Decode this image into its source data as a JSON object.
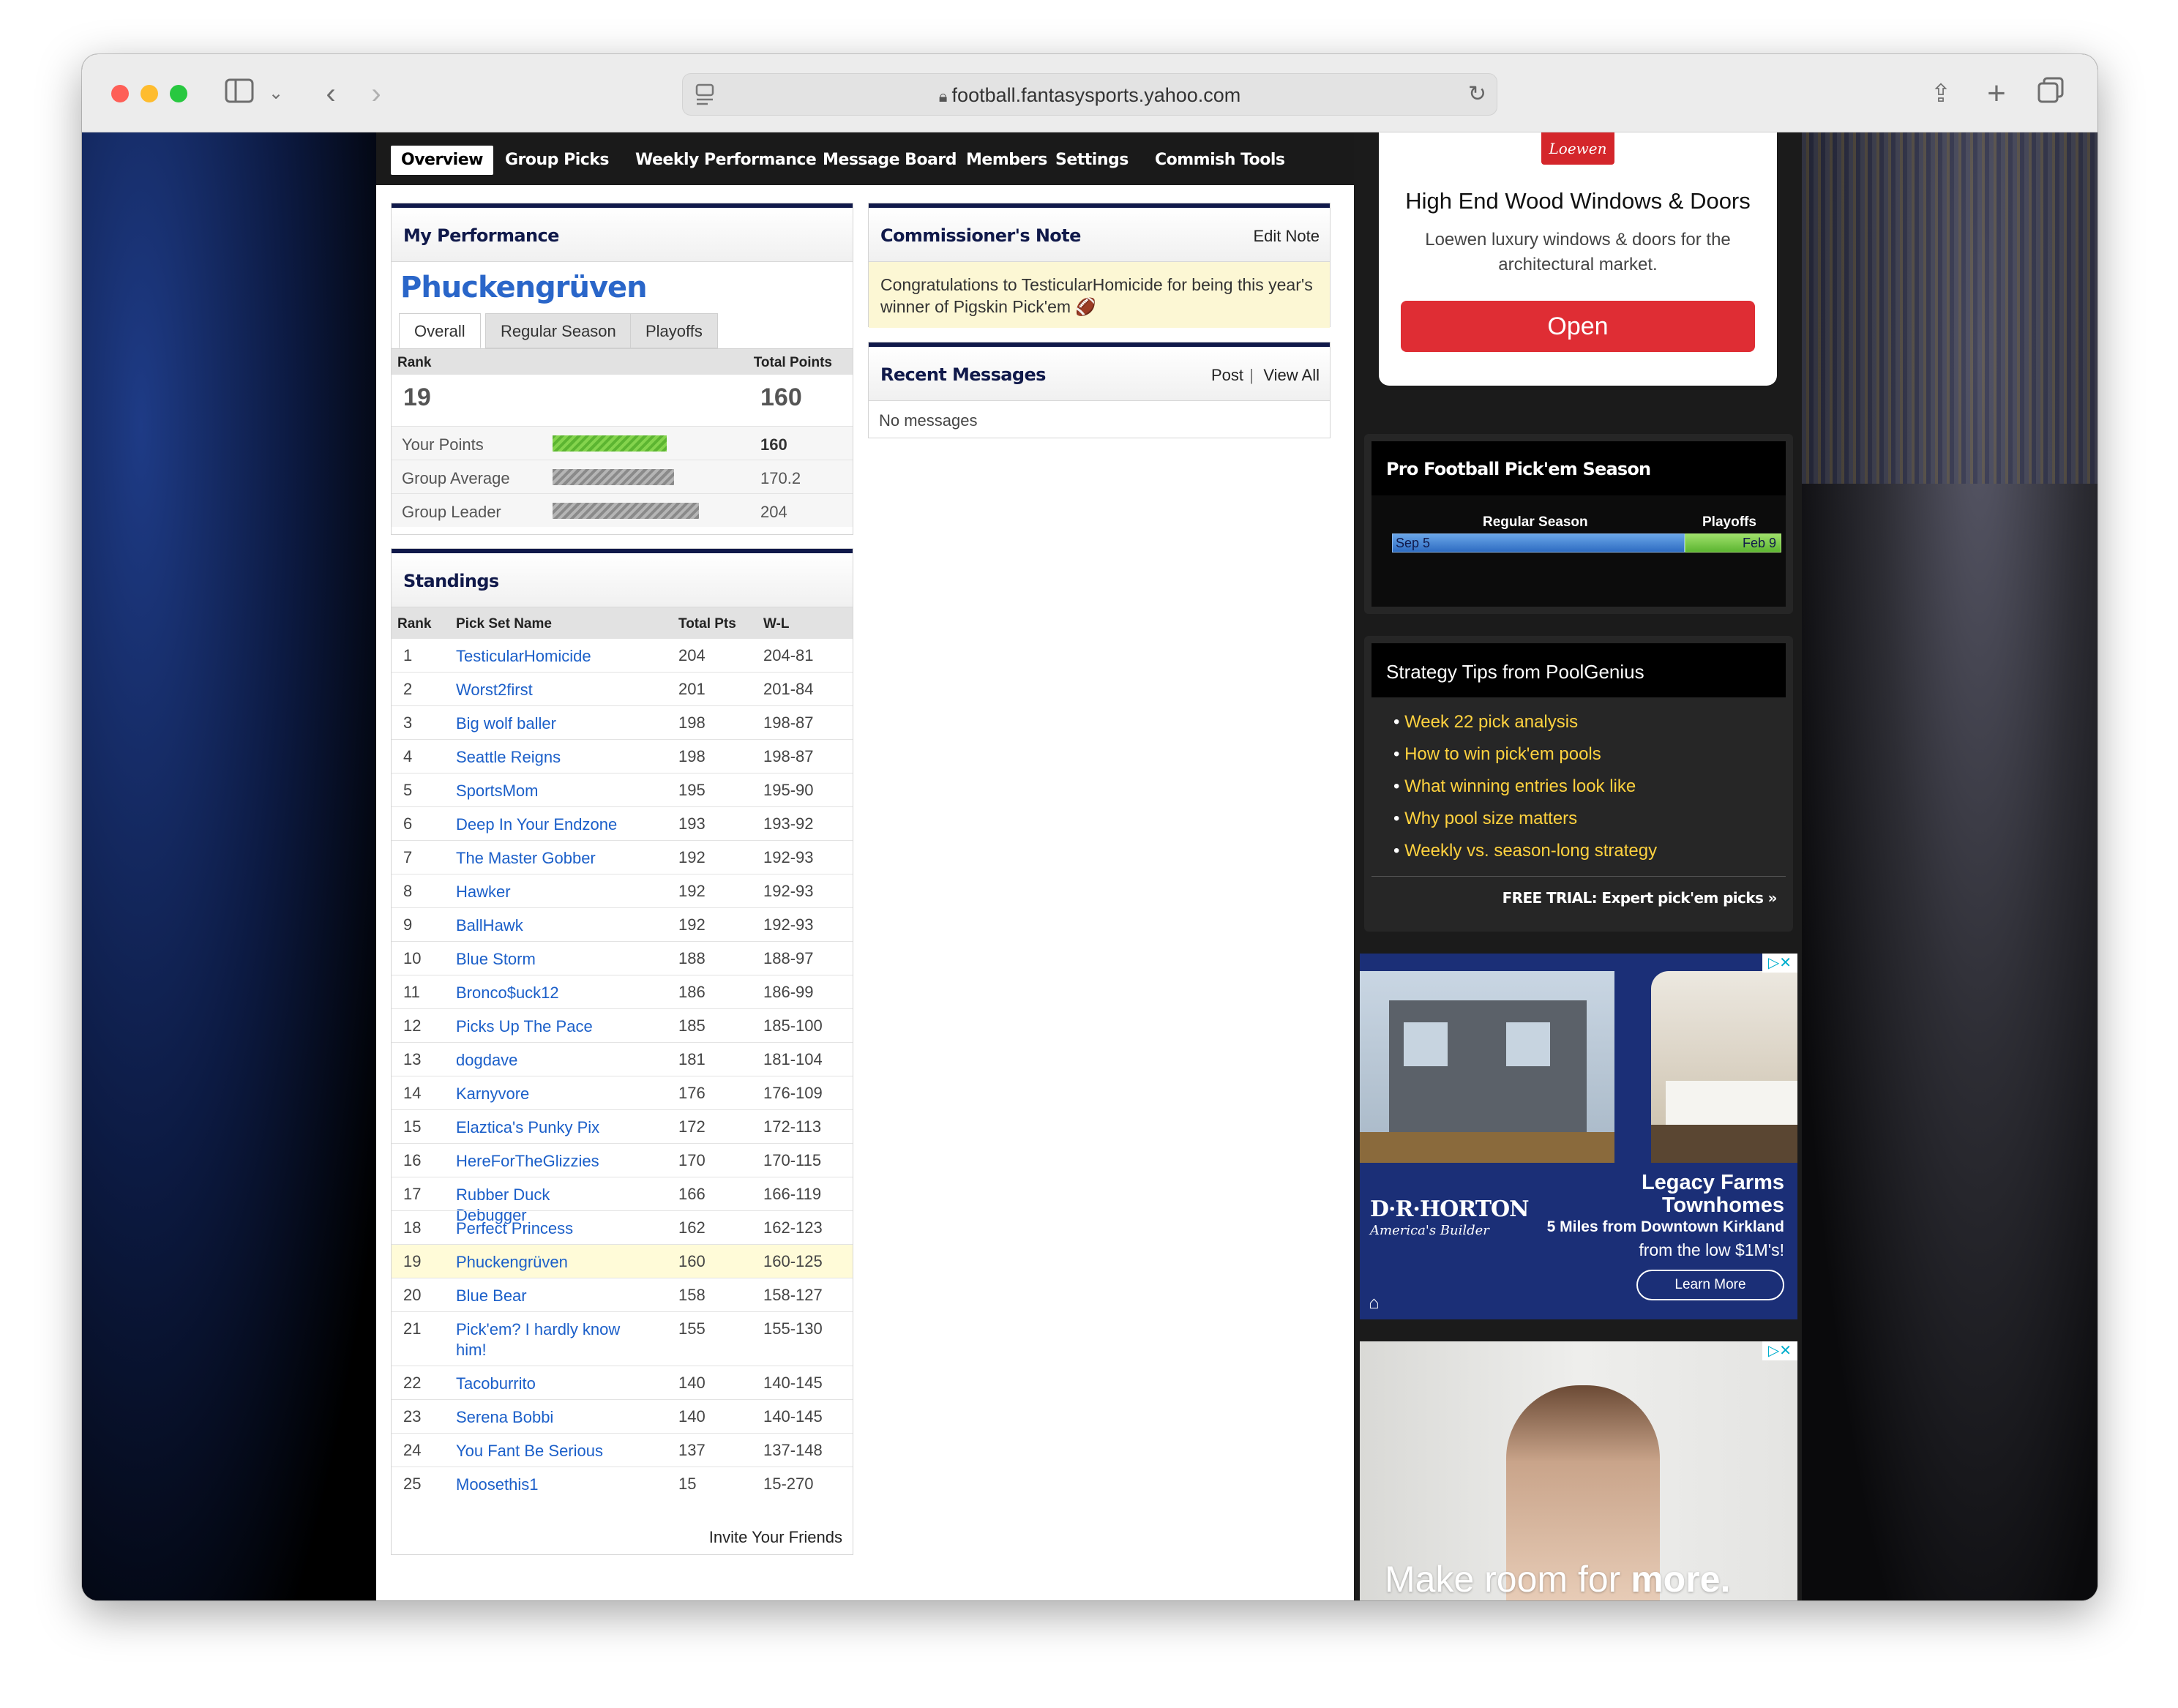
{
  "browser": {
    "url": "football.fantasysports.yahoo.com"
  },
  "nav": {
    "tabs": [
      "Overview",
      "Group Picks",
      "Weekly Performance",
      "Message Board",
      "Members",
      "Settings",
      "Commish Tools"
    ]
  },
  "my_performance": {
    "title": "My Performance",
    "team_name": "Phuckengrüven",
    "subtabs": [
      "Overall",
      "Regular Season",
      "Playoffs"
    ],
    "rank_label": "Rank",
    "total_points_label": "Total Points",
    "rank": "19",
    "total_points": "160",
    "rows": [
      {
        "label": "Your Points",
        "value": "160",
        "fraction": 0.78
      },
      {
        "label": "Group Average",
        "value": "170.2",
        "fraction": 0.83
      },
      {
        "label": "Group Leader",
        "value": "204",
        "fraction": 1.0
      }
    ]
  },
  "standings": {
    "title": "Standings",
    "headers": [
      "Rank",
      "Pick Set Name",
      "Total Pts",
      "W-L"
    ],
    "rows": [
      [
        "1",
        "TesticularHomicide",
        "204",
        "204-81"
      ],
      [
        "2",
        "Worst2first",
        "201",
        "201-84"
      ],
      [
        "3",
        "Big wolf baller",
        "198",
        "198-87"
      ],
      [
        "4",
        "Seattle Reigns",
        "198",
        "198-87"
      ],
      [
        "5",
        "SportsMom",
        "195",
        "195-90"
      ],
      [
        "6",
        "Deep In Your Endzone",
        "193",
        "193-92"
      ],
      [
        "7",
        "The Master Gobber",
        "192",
        "192-93"
      ],
      [
        "8",
        "Hawker",
        "192",
        "192-93"
      ],
      [
        "9",
        "BallHawk",
        "192",
        "192-93"
      ],
      [
        "10",
        "Blue Storm",
        "188",
        "188-97"
      ],
      [
        "11",
        "Bronco$uck12",
        "186",
        "186-99"
      ],
      [
        "12",
        "Picks Up The Pace",
        "185",
        "185-100"
      ],
      [
        "13",
        "dogdave",
        "181",
        "181-104"
      ],
      [
        "14",
        "Karnyvore",
        "176",
        "176-109"
      ],
      [
        "15",
        "Elaztica's Punky Pix",
        "172",
        "172-113"
      ],
      [
        "16",
        "HereForTheGlizzies",
        "170",
        "170-115"
      ],
      [
        "17",
        "Rubber Duck Debugger",
        "166",
        "166-119"
      ],
      [
        "18",
        "Perfect Princess",
        "162",
        "162-123"
      ],
      [
        "19",
        "Phuckengrüven",
        "160",
        "160-125"
      ],
      [
        "20",
        "Blue Bear",
        "158",
        "158-127"
      ],
      [
        "21",
        "Pick'em? I hardly know him!",
        "155",
        "155-130"
      ],
      [
        "22",
        "Tacoburrito",
        "140",
        "140-145"
      ],
      [
        "23",
        "Serena Bobbi",
        "140",
        "140-145"
      ],
      [
        "24",
        "You Fant Be Serious",
        "137",
        "137-148"
      ],
      [
        "25",
        "Moosethis1",
        "15",
        "15-270"
      ]
    ],
    "invite": "Invite Your Friends"
  },
  "commissioner": {
    "title": "Commissioner's Note",
    "edit": "Edit Note",
    "note": "Congratulations to TesticularHomicide for being this year's winner of Pigskin Pick'em 🏈"
  },
  "messages": {
    "title": "Recent Messages",
    "post": "Post",
    "view_all": "View All",
    "empty": "No messages"
  },
  "ad_top": {
    "brand": "Loewen",
    "headline": "High End Wood Windows & Doors",
    "body": "Loewen luxury windows & doors for the architectural market.",
    "button": "Open"
  },
  "season": {
    "title": "Pro Football Pick'em Season",
    "regular": "Regular Season",
    "playoffs": "Playoffs",
    "start": "Sep 5",
    "end": "Feb 9"
  },
  "strategy": {
    "title": "Strategy Tips from PoolGenius",
    "items": [
      "Week 22 pick analysis",
      "How to win pick'em pools",
      "What winning entries look like",
      "Why pool size matters",
      "Weekly vs. season-long strategy"
    ],
    "trial": "FREE TRIAL: Expert pick'em picks »"
  },
  "ad_horton": {
    "brand": "D·R·HORTON",
    "tagline": "America's Builder",
    "title": "Legacy Farms Townhomes",
    "line1": "5 Miles from Downtown Kirkland",
    "line2": "from the low $1M's!",
    "button": "Learn More"
  },
  "ad_bottom": {
    "text_a": "Make room for ",
    "text_b": "more."
  }
}
